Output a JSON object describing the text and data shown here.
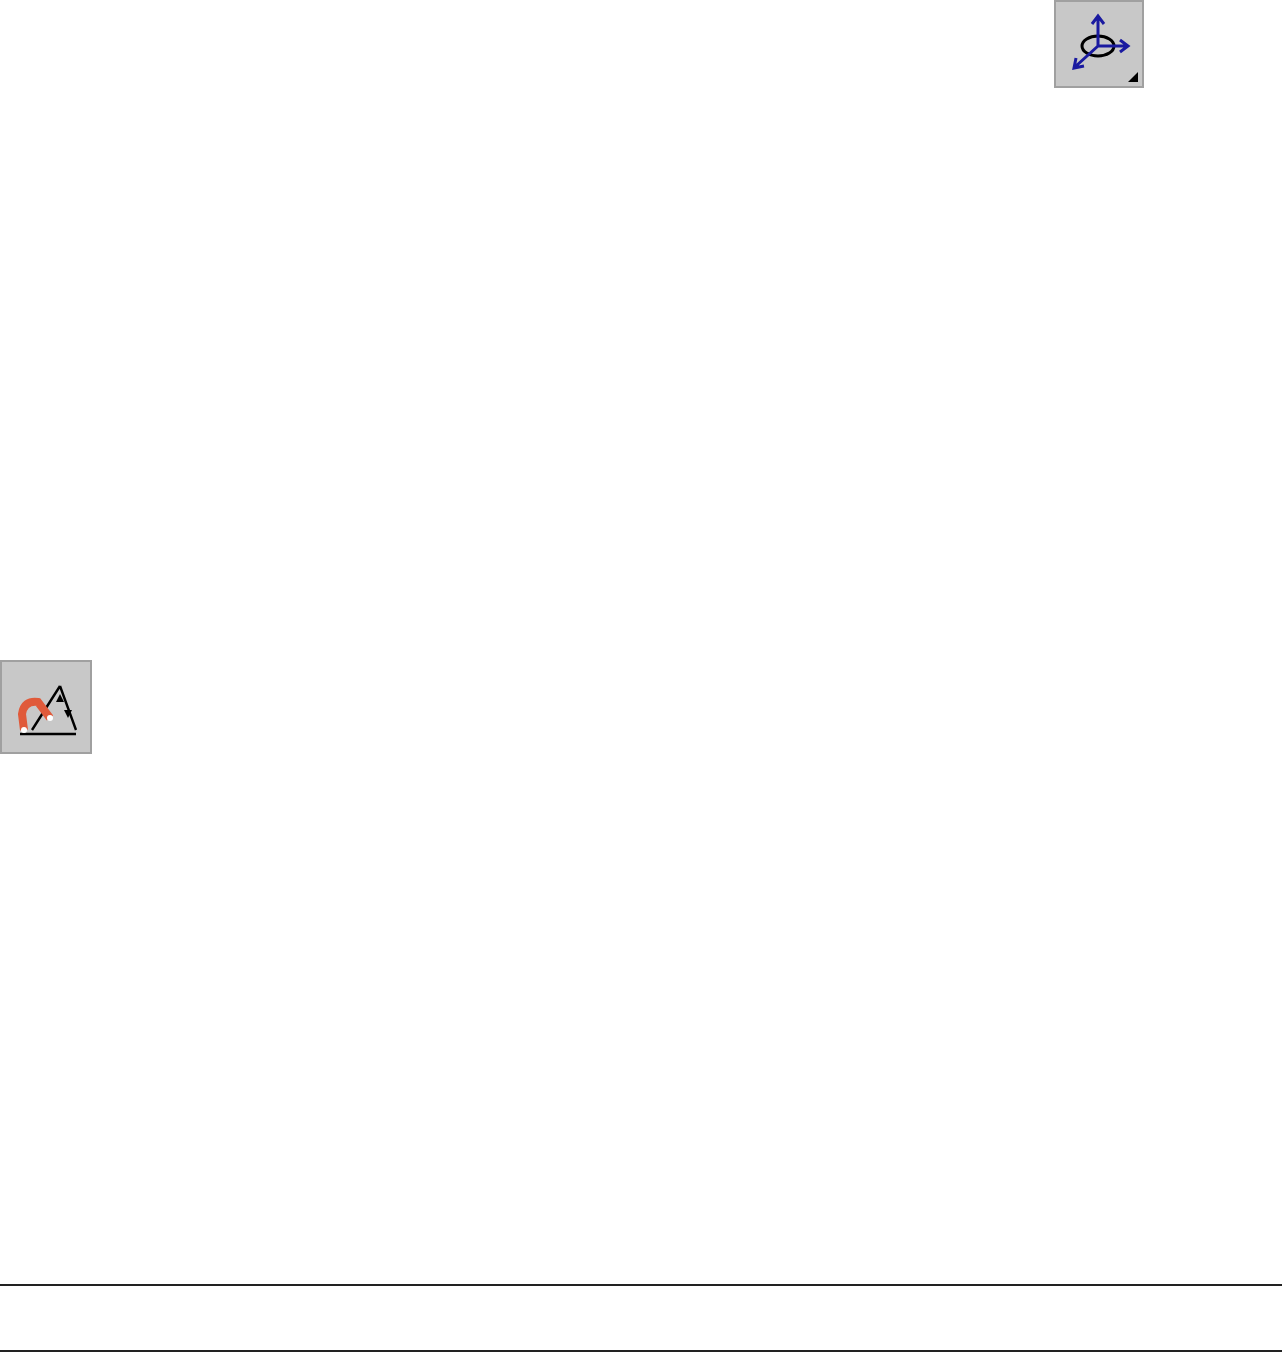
{
  "toolbar_buttons": [
    {
      "kind": "axis"
    },
    {
      "kind": "snap-angle"
    }
  ]
}
